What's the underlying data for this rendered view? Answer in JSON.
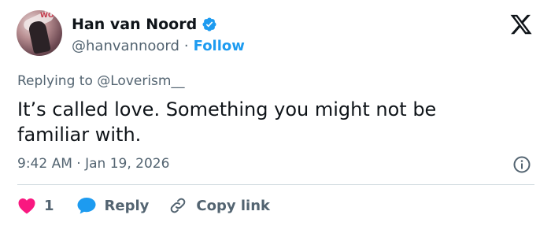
{
  "author": {
    "name": "Han van Noord",
    "handle": "@hanvannoord",
    "separator": "·",
    "follow_label": "Follow",
    "verified": true,
    "avatar_text": "WO"
  },
  "platform_icon": "x-logo-icon",
  "reply_context": {
    "prefix": "Replying to",
    "mention": "@Loverism__"
  },
  "tweet_text": "It’s called love. Something you might not be familiar with.",
  "meta": {
    "timestamp": "9:42 AM · Jan 19, 2026"
  },
  "actions": {
    "like_count": "1",
    "reply_label": "Reply",
    "copy_link_label": "Copy link"
  },
  "colors": {
    "accent": "#1d9bf0",
    "like": "#f91880",
    "secondary_text": "#536471",
    "primary_text": "#0f1419",
    "divider": "#cfd9de"
  }
}
